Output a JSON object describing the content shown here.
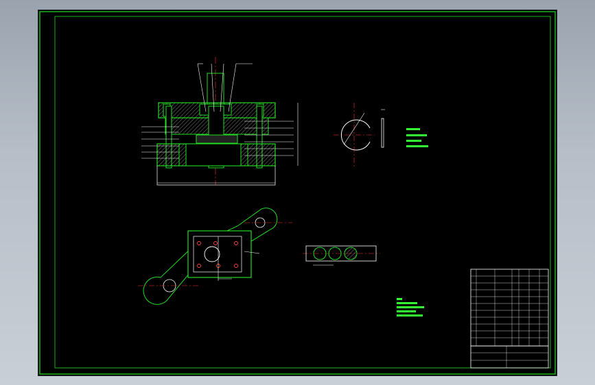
{
  "colors": {
    "background": "#000000",
    "frame": "#20c020",
    "part_outline": "#22dd22",
    "leader": "#ffffff",
    "centerline": "#ff3333",
    "hatch": "#d9d9d9",
    "dimension": "#ffffff",
    "note": "#33ff33",
    "workpiece": "#e8d8b0"
  },
  "icons": {
    "title_block": "table-grid-icon",
    "punch": "punch-icon"
  }
}
